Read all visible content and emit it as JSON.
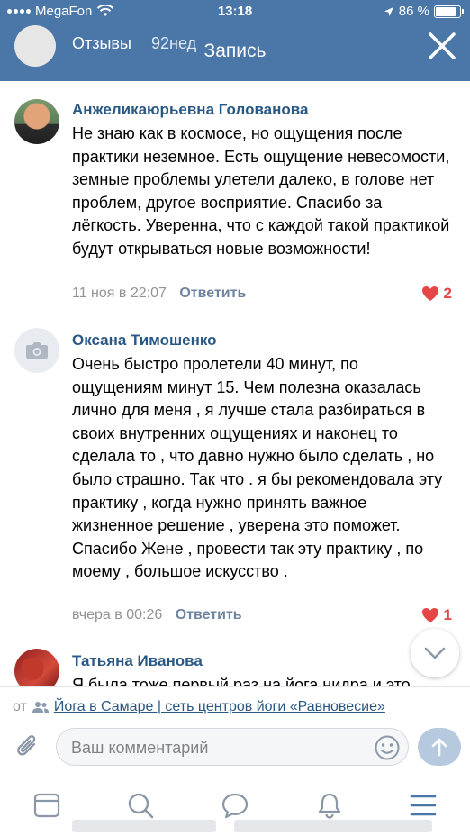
{
  "status_bar": {
    "carrier": "MegaFon",
    "time": "13:18",
    "battery": "86 %",
    "battery_level": 0.86
  },
  "header": {
    "reviews_link": "Отзывы",
    "time_ago": "92нед",
    "title": "Запись",
    "close_icon": "close-icon"
  },
  "comments": [
    {
      "author": "Анжеликаюрьевна Голованова",
      "text": "Не знаю как в космосе, но ощущения после практики неземное. Есть ощущение невесомости, земные проблемы улетели далеко, в голове нет проблем, другое восприятие.  Спасибо за лёгкость. Уверенна, что с каждой такой практикой будут открываться новые возможности!",
      "date": "11 ноя в 22:07",
      "reply_label": "Ответить",
      "likes": "2"
    },
    {
      "author": "Оксана Тимошенко",
      "text": "Очень быстро пролетели 40 минут, по ощущениям минут 15. Чем полезна оказалась лично для меня , я лучше стала разбираться в своих внутренних ощущениях и наконец то сделала то , что давно нужно было сделать , но было страшно. Так что . я бы рекомендовала эту практику , когда нужно принять важное жизненное решение , уверена это поможет. Спасибо Жене , провести так эту практику , по моему , большое искусство .",
      "date": "вчера в 00:26",
      "reply_label": "Ответить",
      "likes": "1"
    },
    {
      "author": "Татьяна Иванова",
      "text": "Я была тоже первый раз на йога нидра и это"
    }
  ],
  "source": {
    "prefix": "от",
    "link": "Йога в Самаре | сеть центров йоги «Равновесие»"
  },
  "composer": {
    "placeholder": "Ваш комментарий"
  },
  "tabbar": {
    "items": [
      "news-icon",
      "search-icon",
      "messages-icon",
      "notifications-icon",
      "menu-icon"
    ]
  },
  "colors": {
    "header": "#4a76a8",
    "author": "#2a5885",
    "like": "#e64646",
    "send": "#b7c9de"
  }
}
